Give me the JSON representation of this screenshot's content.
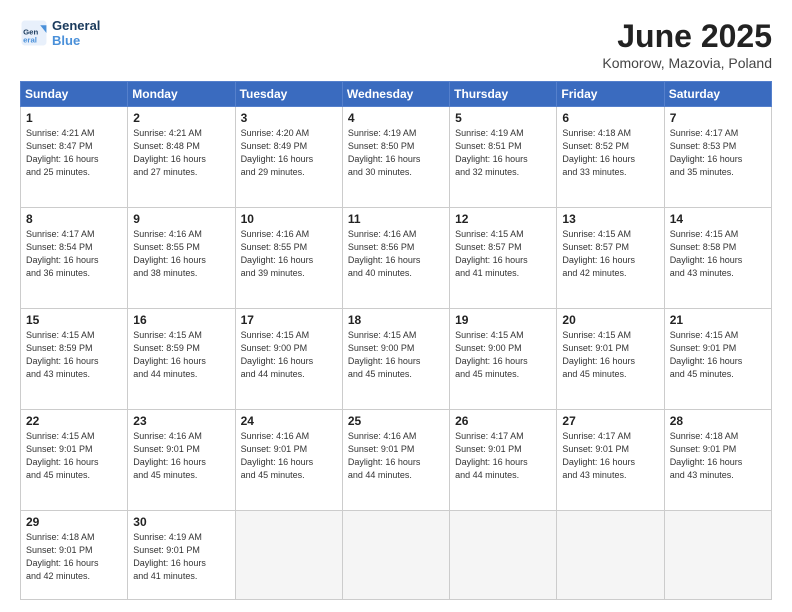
{
  "header": {
    "logo_line1": "General",
    "logo_line2": "Blue",
    "month_title": "June 2025",
    "location": "Komorow, Mazovia, Poland"
  },
  "weekdays": [
    "Sunday",
    "Monday",
    "Tuesday",
    "Wednesday",
    "Thursday",
    "Friday",
    "Saturday"
  ],
  "weeks": [
    [
      {
        "day": "1",
        "info": "Sunrise: 4:21 AM\nSunset: 8:47 PM\nDaylight: 16 hours\nand 25 minutes."
      },
      {
        "day": "2",
        "info": "Sunrise: 4:21 AM\nSunset: 8:48 PM\nDaylight: 16 hours\nand 27 minutes."
      },
      {
        "day": "3",
        "info": "Sunrise: 4:20 AM\nSunset: 8:49 PM\nDaylight: 16 hours\nand 29 minutes."
      },
      {
        "day": "4",
        "info": "Sunrise: 4:19 AM\nSunset: 8:50 PM\nDaylight: 16 hours\nand 30 minutes."
      },
      {
        "day": "5",
        "info": "Sunrise: 4:19 AM\nSunset: 8:51 PM\nDaylight: 16 hours\nand 32 minutes."
      },
      {
        "day": "6",
        "info": "Sunrise: 4:18 AM\nSunset: 8:52 PM\nDaylight: 16 hours\nand 33 minutes."
      },
      {
        "day": "7",
        "info": "Sunrise: 4:17 AM\nSunset: 8:53 PM\nDaylight: 16 hours\nand 35 minutes."
      }
    ],
    [
      {
        "day": "8",
        "info": "Sunrise: 4:17 AM\nSunset: 8:54 PM\nDaylight: 16 hours\nand 36 minutes."
      },
      {
        "day": "9",
        "info": "Sunrise: 4:16 AM\nSunset: 8:55 PM\nDaylight: 16 hours\nand 38 minutes."
      },
      {
        "day": "10",
        "info": "Sunrise: 4:16 AM\nSunset: 8:55 PM\nDaylight: 16 hours\nand 39 minutes."
      },
      {
        "day": "11",
        "info": "Sunrise: 4:16 AM\nSunset: 8:56 PM\nDaylight: 16 hours\nand 40 minutes."
      },
      {
        "day": "12",
        "info": "Sunrise: 4:15 AM\nSunset: 8:57 PM\nDaylight: 16 hours\nand 41 minutes."
      },
      {
        "day": "13",
        "info": "Sunrise: 4:15 AM\nSunset: 8:57 PM\nDaylight: 16 hours\nand 42 minutes."
      },
      {
        "day": "14",
        "info": "Sunrise: 4:15 AM\nSunset: 8:58 PM\nDaylight: 16 hours\nand 43 minutes."
      }
    ],
    [
      {
        "day": "15",
        "info": "Sunrise: 4:15 AM\nSunset: 8:59 PM\nDaylight: 16 hours\nand 43 minutes."
      },
      {
        "day": "16",
        "info": "Sunrise: 4:15 AM\nSunset: 8:59 PM\nDaylight: 16 hours\nand 44 minutes."
      },
      {
        "day": "17",
        "info": "Sunrise: 4:15 AM\nSunset: 9:00 PM\nDaylight: 16 hours\nand 44 minutes."
      },
      {
        "day": "18",
        "info": "Sunrise: 4:15 AM\nSunset: 9:00 PM\nDaylight: 16 hours\nand 45 minutes."
      },
      {
        "day": "19",
        "info": "Sunrise: 4:15 AM\nSunset: 9:00 PM\nDaylight: 16 hours\nand 45 minutes."
      },
      {
        "day": "20",
        "info": "Sunrise: 4:15 AM\nSunset: 9:01 PM\nDaylight: 16 hours\nand 45 minutes."
      },
      {
        "day": "21",
        "info": "Sunrise: 4:15 AM\nSunset: 9:01 PM\nDaylight: 16 hours\nand 45 minutes."
      }
    ],
    [
      {
        "day": "22",
        "info": "Sunrise: 4:15 AM\nSunset: 9:01 PM\nDaylight: 16 hours\nand 45 minutes."
      },
      {
        "day": "23",
        "info": "Sunrise: 4:16 AM\nSunset: 9:01 PM\nDaylight: 16 hours\nand 45 minutes."
      },
      {
        "day": "24",
        "info": "Sunrise: 4:16 AM\nSunset: 9:01 PM\nDaylight: 16 hours\nand 45 minutes."
      },
      {
        "day": "25",
        "info": "Sunrise: 4:16 AM\nSunset: 9:01 PM\nDaylight: 16 hours\nand 44 minutes."
      },
      {
        "day": "26",
        "info": "Sunrise: 4:17 AM\nSunset: 9:01 PM\nDaylight: 16 hours\nand 44 minutes."
      },
      {
        "day": "27",
        "info": "Sunrise: 4:17 AM\nSunset: 9:01 PM\nDaylight: 16 hours\nand 43 minutes."
      },
      {
        "day": "28",
        "info": "Sunrise: 4:18 AM\nSunset: 9:01 PM\nDaylight: 16 hours\nand 43 minutes."
      }
    ],
    [
      {
        "day": "29",
        "info": "Sunrise: 4:18 AM\nSunset: 9:01 PM\nDaylight: 16 hours\nand 42 minutes."
      },
      {
        "day": "30",
        "info": "Sunrise: 4:19 AM\nSunset: 9:01 PM\nDaylight: 16 hours\nand 41 minutes."
      },
      {
        "day": "",
        "info": ""
      },
      {
        "day": "",
        "info": ""
      },
      {
        "day": "",
        "info": ""
      },
      {
        "day": "",
        "info": ""
      },
      {
        "day": "",
        "info": ""
      }
    ]
  ]
}
